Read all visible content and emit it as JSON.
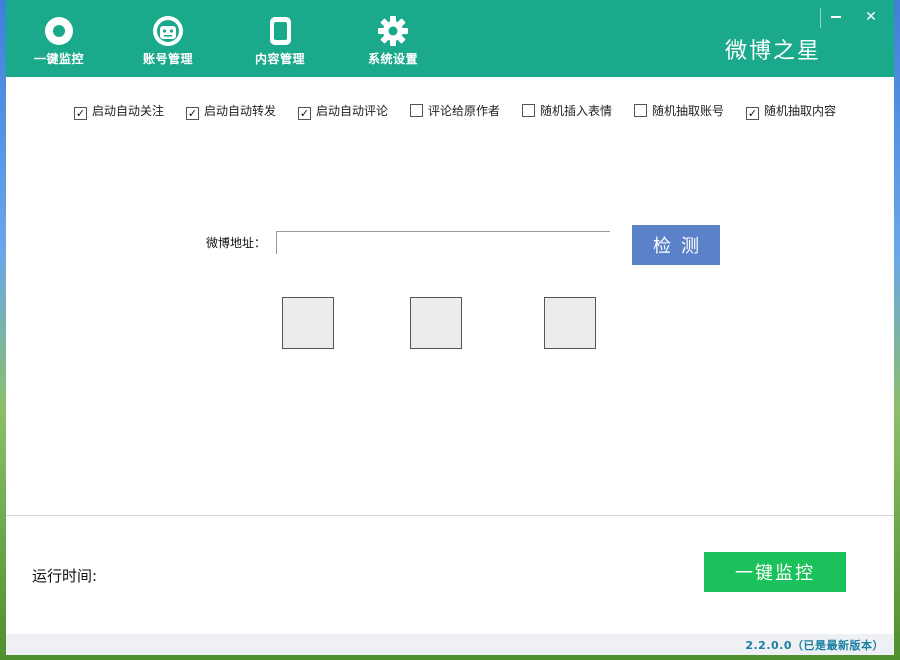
{
  "nav": {
    "items": [
      {
        "label": "一键监控",
        "icon": "record-icon"
      },
      {
        "label": "账号管理",
        "icon": "robot-account-icon"
      },
      {
        "label": "内容管理",
        "icon": "document-icon"
      },
      {
        "label": "系统设置",
        "icon": "gear-icon"
      }
    ]
  },
  "brand": "微博之星",
  "window_controls": {
    "close": "✕"
  },
  "options": [
    {
      "label": "启动自动关注",
      "checked": true
    },
    {
      "label": "启动自动转发",
      "checked": true
    },
    {
      "label": "启动自动评论",
      "checked": true
    },
    {
      "label": "评论给原作者",
      "checked": false
    },
    {
      "label": "随机插入表情",
      "checked": false
    },
    {
      "label": "随机抽取账号",
      "checked": false
    },
    {
      "label": "随机抽取内容",
      "checked": true
    }
  ],
  "address": {
    "label": "微博地址：",
    "value": "",
    "placeholder": ""
  },
  "detect_button": "检测",
  "runtime_label": "运行时间:",
  "monitor_button": "一键监控",
  "version": "2.2.0.0（已是最新版本）",
  "colors": {
    "header": "#1aa98b",
    "detect": "#5b82c9",
    "monitor": "#1bc15a"
  }
}
